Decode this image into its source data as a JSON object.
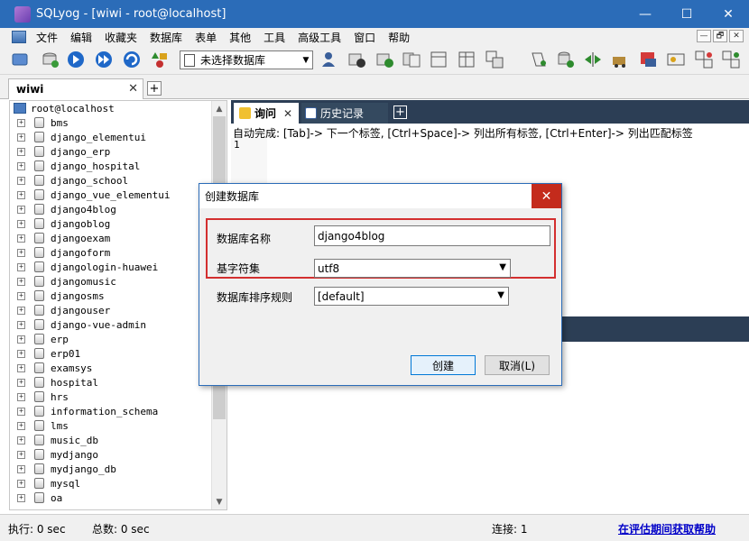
{
  "window": {
    "title": "SQLyog - [wiwi - root@localhost]",
    "minimize": "—",
    "maximize": "☐",
    "close": "✕"
  },
  "menu": [
    "文件",
    "编辑",
    "收藏夹",
    "数据库",
    "表单",
    "其他",
    "工具",
    "高级工具",
    "窗口",
    "帮助"
  ],
  "mdi_buttons": [
    "—",
    "🗗",
    "✕"
  ],
  "toolbar": {
    "db_select_value": "未选择数据库"
  },
  "connection_tab": {
    "label": "wiwi",
    "close": "✕",
    "add": "+"
  },
  "tree": {
    "root": "root@localhost",
    "databases": [
      "bms",
      "django_elementui",
      "django_erp",
      "django_hospital",
      "django_school",
      "django_vue_elementui",
      "django4blog",
      "djangoblog",
      "djangoexam",
      "djangoform",
      "djangologin-huawei",
      "djangomusic",
      "djangosms",
      "djangouser",
      "django-vue-admin",
      "erp",
      "erp01",
      "examsys",
      "hospital",
      "hrs",
      "information_schema",
      "lms",
      "music_db",
      "mydjango",
      "mydjango_db",
      "mysql",
      "oa"
    ],
    "expand_glyph": "+"
  },
  "query_tabs": {
    "query_label": "询问",
    "query_close": "✕",
    "history_label": "历史记录",
    "add": "+"
  },
  "editor": {
    "autocomplete_hint": "自动完成: [Tab]-> 下一个标签, [Ctrl+Space]-> 列出所有标签, [Ctrl+Enter]-> 列出匹配标签",
    "line_number": "1"
  },
  "dialog": {
    "title": "创建数据库",
    "close": "✕",
    "db_name_label": "数据库名称",
    "db_name_value": "django4blog",
    "charset_label": "基字符集",
    "charset_value": "utf8",
    "collation_label": "数据库排序规则",
    "collation_value": "[default]",
    "create_button": "创建",
    "cancel_button": "取消(L)"
  },
  "status": {
    "exec": "执行: 0 sec",
    "total": "总数: 0 sec",
    "connections": "连接: 1",
    "help_link": "在评估期间获取帮助"
  },
  "colors": {
    "titlebar": "#2b6cb8",
    "tab_dark": "#2c3e55",
    "highlight_border": "#d32f2f",
    "close_red": "#c42b1c",
    "link": "#0000c8"
  }
}
